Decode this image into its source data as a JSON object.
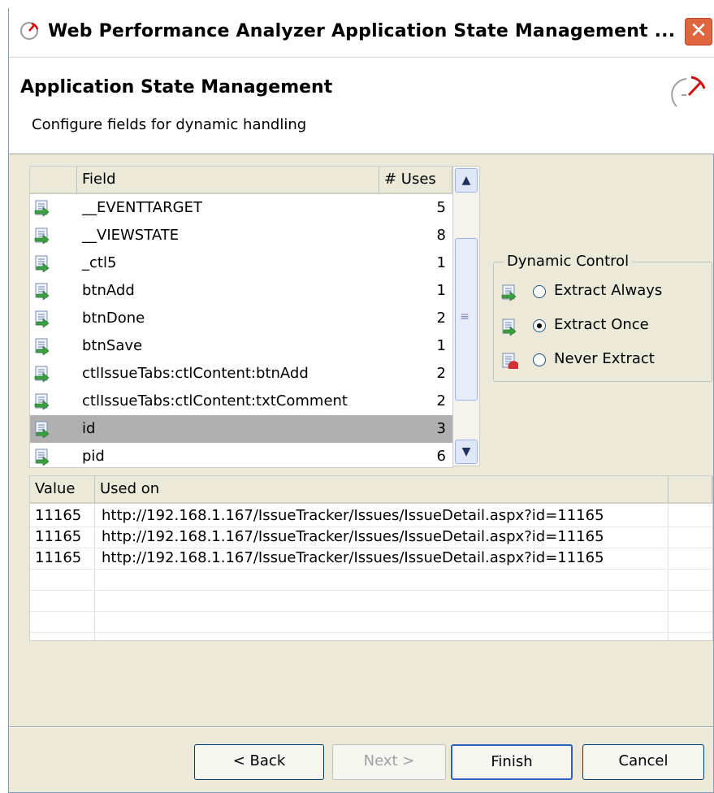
{
  "window": {
    "title": "Web Performance Analyzer Application State Management ...",
    "close_label": "✕"
  },
  "header": {
    "title": "Application State Management",
    "subtitle": "Configure fields for dynamic handling"
  },
  "field_table": {
    "columns": [
      "Field",
      "# Uses"
    ],
    "rows": [
      {
        "field": "__EVENTTARGET",
        "uses": "5",
        "icon": "extract-always-icon"
      },
      {
        "field": "__VIEWSTATE",
        "uses": "8",
        "icon": "extract-always-icon"
      },
      {
        "field": "_ctl5",
        "uses": "1",
        "icon": "extract-once-icon"
      },
      {
        "field": "btnAdd",
        "uses": "1",
        "icon": "extract-once-icon"
      },
      {
        "field": "btnDone",
        "uses": "2",
        "icon": "extract-once-icon"
      },
      {
        "field": "btnSave",
        "uses": "1",
        "icon": "extract-once-icon"
      },
      {
        "field": "ctlIssueTabs:ctlContent:btnAdd",
        "uses": "2",
        "icon": "extract-always-icon"
      },
      {
        "field": "ctlIssueTabs:ctlContent:txtComment",
        "uses": "2",
        "icon": "extract-always-icon"
      },
      {
        "field": "id",
        "uses": "3",
        "icon": "extract-once-icon",
        "selected": true
      },
      {
        "field": "pid",
        "uses": "6",
        "icon": "extract-once-icon"
      }
    ]
  },
  "dynamic_control": {
    "legend": "Dynamic Control",
    "options": [
      {
        "label": "Extract Always",
        "checked": false,
        "icon": "extract-always-icon"
      },
      {
        "label": "Extract Once",
        "checked": true,
        "icon": "extract-once-icon"
      },
      {
        "label": "Never Extract",
        "checked": false,
        "icon": "never-extract-icon"
      }
    ]
  },
  "value_table": {
    "columns": [
      "Value",
      "Used on"
    ],
    "rows": [
      {
        "value": "11165",
        "used_on": "http://192.168.1.167/IssueTracker/Issues/IssueDetail.aspx?id=11165"
      },
      {
        "value": "11165",
        "used_on": "http://192.168.1.167/IssueTracker/Issues/IssueDetail.aspx?id=11165"
      },
      {
        "value": "11165",
        "used_on": "http://192.168.1.167/IssueTracker/Issues/IssueDetail.aspx?id=11165"
      }
    ]
  },
  "buttons": {
    "back": "< Back",
    "next": "Next >",
    "finish": "Finish",
    "cancel": "Cancel"
  },
  "colors": {
    "window_bg": "#ece9d8",
    "selected_row": "#b0b0b0",
    "close_button": "#e0663f"
  }
}
